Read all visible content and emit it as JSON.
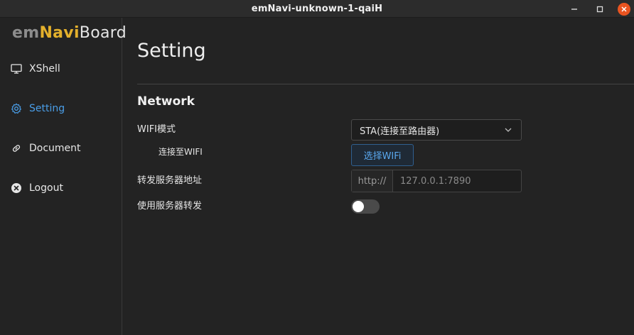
{
  "window": {
    "title": "emNavi-unknown-1-qaiH"
  },
  "brand": {
    "part1": "em",
    "part2": "Navi",
    "part3": "Board"
  },
  "sidebar": {
    "items": [
      {
        "label": "XShell",
        "icon": "monitor-icon",
        "active": false
      },
      {
        "label": "Setting",
        "icon": "gear-icon",
        "active": true
      },
      {
        "label": "Document",
        "icon": "link-icon",
        "active": false
      },
      {
        "label": "Logout",
        "icon": "close-circle-icon",
        "active": false
      }
    ]
  },
  "main": {
    "title": "Setting",
    "section": "Network",
    "wifi_mode": {
      "label": "WIFI模式",
      "value": "STA(连接至路由器)"
    },
    "connect_wifi": {
      "label": "连接至WIFI",
      "button": "选择WIFi"
    },
    "forward_addr": {
      "label": "转发服务器地址",
      "prefix": "http://",
      "placeholder": "127.0.0.1:7890",
      "value": ""
    },
    "use_forward": {
      "label": "使用服务器转发",
      "enabled": false
    }
  },
  "colors": {
    "accent": "#4a9ee8",
    "brand_yellow": "#e3b02c",
    "close": "#e95420",
    "background": "#232323"
  }
}
